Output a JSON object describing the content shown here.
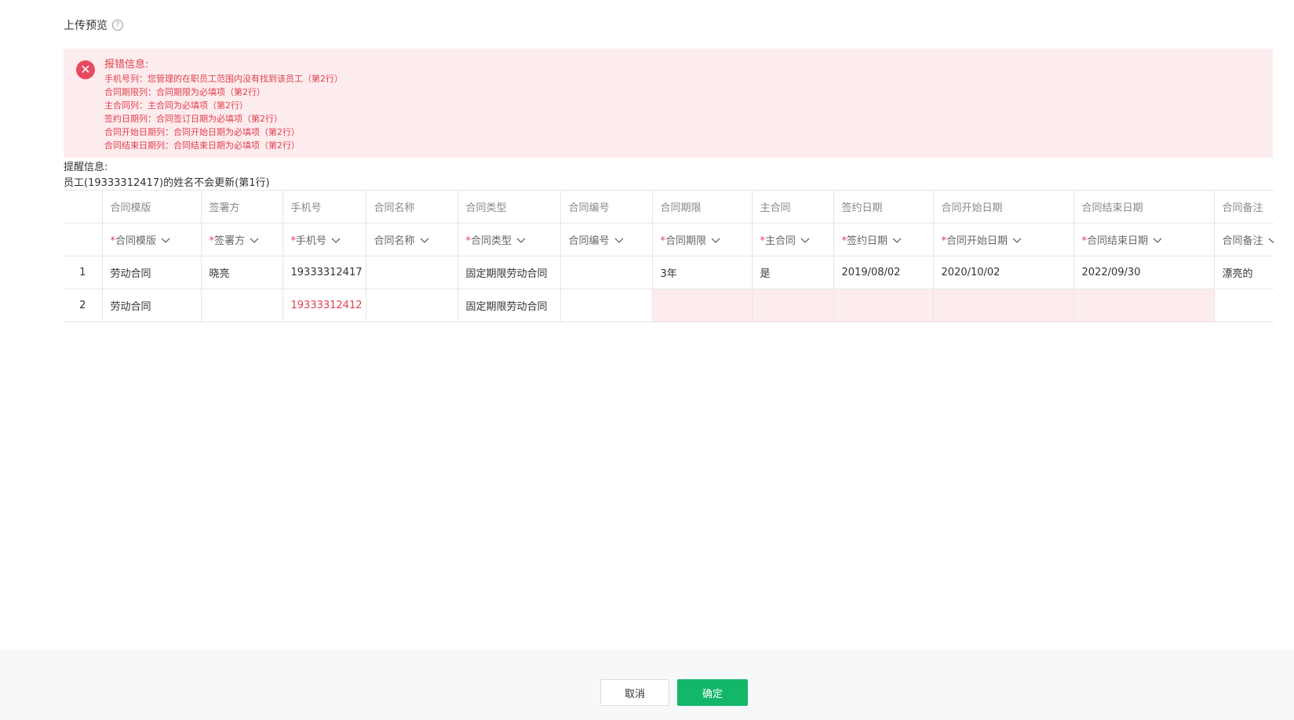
{
  "page": {
    "title": "上传预览",
    "help_icon": "question-circle-icon"
  },
  "error": {
    "icon": "close-circle-icon",
    "title": "报错信息:",
    "items": [
      "手机号列：您管理的在职员工范围内没有找到该员工（第2行）",
      "合同期限列：合同期限为必填项（第2行）",
      "主合同列：主合同为必填项（第2行）",
      "签约日期列：合同签订日期为必填项（第2行）",
      "合同开始日期列：合同开始日期为必填项（第2行）",
      "合同结束日期列：合同结束日期为必填项（第2行）"
    ]
  },
  "tip": {
    "title": "提醒信息:",
    "text": "员工(19333312417)的姓名不会更新(第1行)"
  },
  "table": {
    "headers": [
      "合同模版",
      "签署方",
      "手机号",
      "合同名称",
      "合同类型",
      "合同编号",
      "合同期限",
      "主合同",
      "签约日期",
      "合同开始日期",
      "合同结束日期",
      "合同备注"
    ],
    "mappings": [
      {
        "label": "合同模版",
        "required": true
      },
      {
        "label": "签署方",
        "required": true
      },
      {
        "label": "手机号",
        "required": true
      },
      {
        "label": "合同名称",
        "required": false
      },
      {
        "label": "合同类型",
        "required": true
      },
      {
        "label": "合同编号",
        "required": false
      },
      {
        "label": "合同期限",
        "required": true
      },
      {
        "label": "主合同",
        "required": true
      },
      {
        "label": "签约日期",
        "required": true
      },
      {
        "label": "合同开始日期",
        "required": true
      },
      {
        "label": "合同结束日期",
        "required": true
      },
      {
        "label": "合同备注",
        "required": false
      }
    ],
    "rows": [
      {
        "num": "1",
        "cells": [
          "劳动合同",
          "晓亮",
          "19333312417",
          "",
          "固定期限劳动合同",
          "",
          "3年",
          "是",
          "2019/08/02",
          "2020/10/02",
          "2022/09/30",
          "漂亮的"
        ],
        "errors": []
      },
      {
        "num": "2",
        "cells": [
          "劳动合同",
          "",
          "19333312412",
          "",
          "固定期限劳动合同",
          "",
          "",
          "",
          "",
          "",
          "",
          ""
        ],
        "errors": [
          2,
          6,
          7,
          8,
          9,
          10
        ]
      }
    ],
    "required_mark": "*",
    "chevron_icon": "chevron-down-icon"
  },
  "footer": {
    "cancel_label": "取消",
    "confirm_label": "确定"
  },
  "colors": {
    "error_text": "#e0404f",
    "error_bg": "#fdecee",
    "primary": "#12b76a"
  }
}
